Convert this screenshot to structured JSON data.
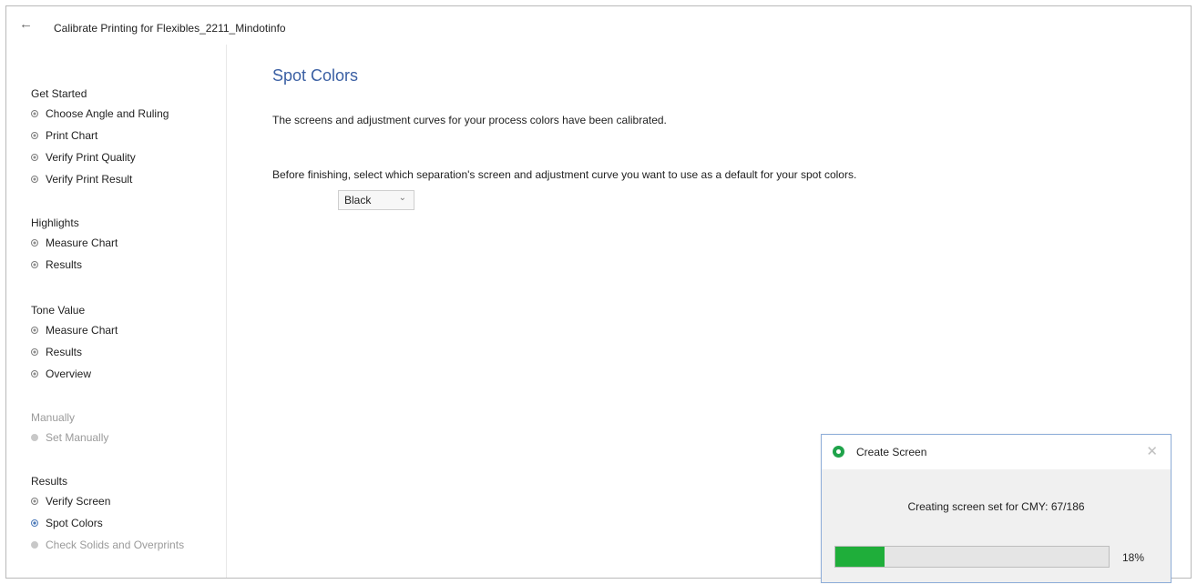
{
  "window": {
    "title": "Calibrate Printing for Flexibles_2211_Mindotinfo",
    "back_icon": "back-arrow-icon"
  },
  "sidebar": {
    "sections": [
      {
        "title": "Get Started",
        "disabled": false,
        "items": [
          {
            "label": "Choose Angle and Ruling",
            "state": "done"
          },
          {
            "label": "Print Chart",
            "state": "done"
          },
          {
            "label": "Verify Print Quality",
            "state": "done"
          },
          {
            "label": "Verify Print Result",
            "state": "done"
          }
        ]
      },
      {
        "title": "Highlights",
        "disabled": false,
        "items": [
          {
            "label": "Measure Chart",
            "state": "done"
          },
          {
            "label": "Results",
            "state": "done"
          }
        ]
      },
      {
        "title": "Tone Value",
        "disabled": false,
        "items": [
          {
            "label": "Measure Chart",
            "state": "done"
          },
          {
            "label": "Results",
            "state": "done"
          },
          {
            "label": "Overview",
            "state": "done"
          }
        ]
      },
      {
        "title": "Manually",
        "disabled": true,
        "items": [
          {
            "label": "Set Manually",
            "state": "disabled"
          }
        ]
      },
      {
        "title": "Results",
        "disabled": false,
        "items": [
          {
            "label": "Verify Screen",
            "state": "done"
          },
          {
            "label": "Spot Colors",
            "state": "current"
          },
          {
            "label": "Check Solids and Overprints",
            "state": "disabled"
          }
        ]
      }
    ]
  },
  "main": {
    "title": "Spot Colors",
    "description": "The screens and adjustment curves for your process colors have been calibrated.",
    "instruction": "Before finishing, select which separation's screen and adjustment curve you want to use as a default for your spot colors.",
    "separation_select": {
      "value": "Black"
    }
  },
  "dialog": {
    "title": "Create Screen",
    "message": "Creating screen set for CMY: 67/186",
    "progress_label": "18%",
    "progress_fraction": 0.18,
    "close_icon": "close-icon"
  },
  "colors": {
    "accent": "#3a5fa3",
    "progress": "#1fae3a",
    "status_icon": "#1fa34a"
  }
}
